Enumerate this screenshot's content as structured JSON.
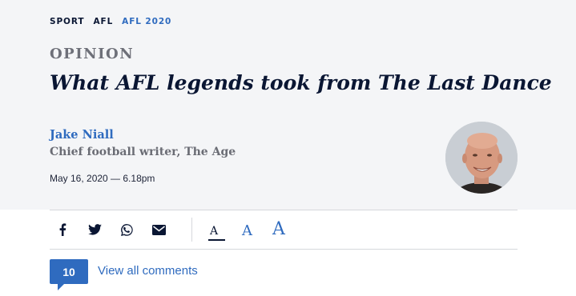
{
  "breadcrumb": {
    "items": [
      {
        "label": "SPORT"
      },
      {
        "label": "AFL"
      },
      {
        "label": "AFL 2020",
        "current": true
      }
    ]
  },
  "article": {
    "kicker": "OPINION",
    "headline": "What AFL legends took from The Last Dance",
    "author_name": "Jake Niall",
    "author_role": "Chief football writer, The Age",
    "published": "May 16, 2020 — 6.18pm"
  },
  "share": {
    "icons": [
      "facebook-icon",
      "twitter-icon",
      "whatsapp-icon",
      "email-icon"
    ]
  },
  "font_size_controls": {
    "small_label": "A",
    "medium_label": "A",
    "large_label": "A",
    "selected": "small"
  },
  "comments": {
    "count": "10",
    "link_label": "View all comments"
  },
  "colors": {
    "accent": "#2f6bbf",
    "headline": "#0a1633",
    "header_background": "#f4f5f7"
  }
}
